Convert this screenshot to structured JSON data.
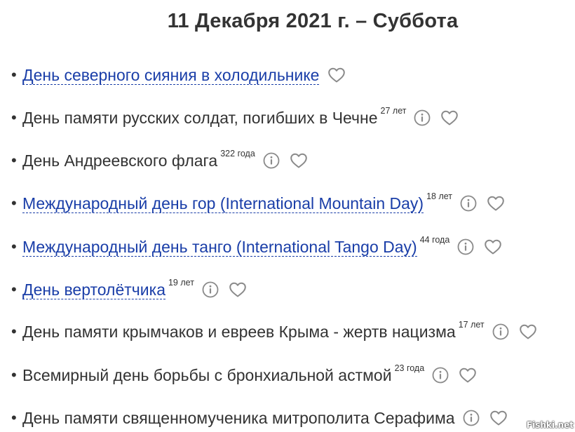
{
  "header": {
    "title": "11 Декабря 2021 г. – Суббота"
  },
  "bullet": "•",
  "items": [
    {
      "label": "День северного сияния в холодильнике",
      "link": true,
      "age": "",
      "info": false
    },
    {
      "label": "День памяти русских солдат, погибших в Чечне",
      "link": false,
      "age": "27 лет",
      "info": true
    },
    {
      "label": "День Андреевского флага",
      "link": false,
      "age": "322 года",
      "info": true
    },
    {
      "label": "Международный день гор (International Mountain Day)",
      "link": true,
      "age": "18 лет",
      "info": true
    },
    {
      "label": "Международный день танго (International Tango Day)",
      "link": true,
      "age": "44 года",
      "info": true
    },
    {
      "label": "День вертолётчика",
      "link": true,
      "age": "19 лет",
      "info": true
    },
    {
      "label": "День памяти крымчаков и евреев Крыма - жертв нацизма",
      "link": false,
      "age": "17 лет",
      "info": true
    },
    {
      "label": "Всемирный день борьбы с бронхиальной астмой",
      "link": false,
      "age": "23 года",
      "info": true
    },
    {
      "label": "День памяти священномученика митрополита Серафима",
      "link": false,
      "age": "",
      "info": true
    }
  ],
  "colors": {
    "text": "#333333",
    "link": "#1a3ea8",
    "icon": "#8a8a8a"
  },
  "icons": {
    "info": "info-circle-icon",
    "favorite": "heart-outline-icon"
  },
  "watermark": "Fishki.net"
}
